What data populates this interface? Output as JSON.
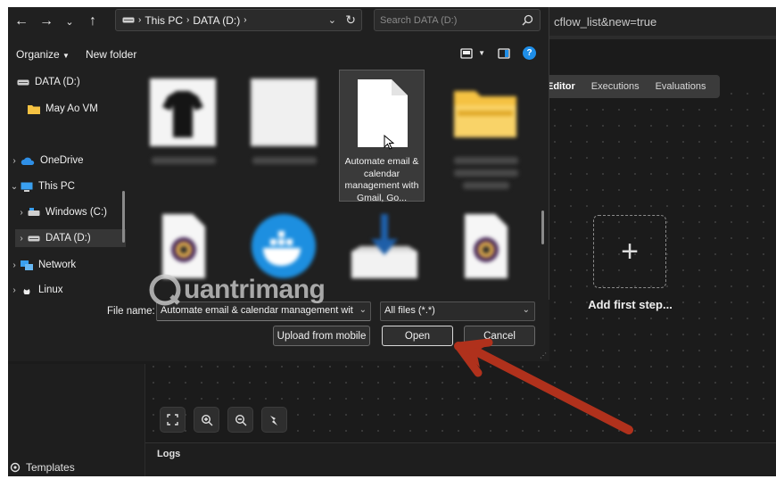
{
  "browser": {
    "url_fragment": "cflow_list&new=true"
  },
  "editor": {
    "tabs": [
      "Editor",
      "Executions",
      "Evaluations"
    ],
    "add_step_label": "Add first step...",
    "logs_label": "Logs",
    "templates_label": "Templates"
  },
  "dialog": {
    "breadcrumb": [
      "This PC",
      "DATA (D:)"
    ],
    "search_placeholder": "Search DATA (D:)",
    "toolbar": {
      "organize": "Organize",
      "new_folder": "New folder"
    },
    "tree": [
      {
        "label": "DATA (D:)",
        "icon": "drive-icon"
      },
      {
        "label": "May Ao VM",
        "icon": "folder-icon"
      },
      {
        "label": "OneDrive",
        "icon": "onedrive-icon"
      },
      {
        "label": "This PC",
        "icon": "computer-icon"
      },
      {
        "label": "Windows (C:)",
        "icon": "drive-icon"
      },
      {
        "label": "DATA (D:)",
        "icon": "drive-icon"
      },
      {
        "label": "Network",
        "icon": "network-icon"
      },
      {
        "label": "Linux",
        "icon": "linux-icon"
      }
    ],
    "files": [
      {
        "name": "",
        "kind": "tshirt-thumbnail"
      },
      {
        "name": "",
        "kind": "blank-thumbnail"
      },
      {
        "name": "Automate email & calendar management with Gmail, Go...",
        "kind": "document-icon",
        "selected": true
      },
      {
        "name": "",
        "kind": "folder-icon"
      },
      {
        "name": "",
        "kind": "media-file-icon"
      },
      {
        "name": "",
        "kind": "docker-icon"
      },
      {
        "name": "",
        "kind": "download-icon"
      },
      {
        "name": "",
        "kind": "media-file-icon"
      }
    ],
    "file_name_label": "File name:",
    "file_name_value": "Automate email & calendar management wit",
    "file_type_value": "All files (*.*)",
    "buttons": {
      "upload": "Upload from mobile",
      "open": "Open",
      "cancel": "Cancel"
    }
  },
  "watermark": {
    "text": "uantrimang"
  },
  "colors": {
    "annotation_arrow": "#b0311c",
    "help_blue": "#1e8ee8",
    "folder_yellow": "#f5c242"
  }
}
